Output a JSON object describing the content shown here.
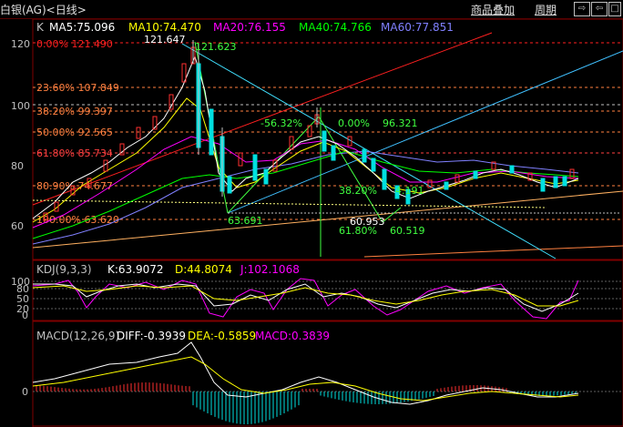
{
  "header": {
    "title": "白银(AG)<日线>",
    "overlay_btn": "商品叠加",
    "period_btn": "周期"
  },
  "main_legend": {
    "k": "K",
    "ma5": "MA5:75.096",
    "ma10": "MA10:74.470",
    "ma20": "MA20:76.155",
    "ma40": "MA40:74.766",
    "ma60": "MA60:77.851",
    "colors": {
      "ma5": "#ffffff",
      "ma10": "#ffff00",
      "ma20": "#ff00ff",
      "ma40": "#00ff00",
      "ma60": "#8080ff"
    }
  },
  "price_axis": [
    "120",
    "100",
    "80",
    "60"
  ],
  "fib_levels": [
    {
      "label": "0.00% 121.490",
      "color": "#ff2020",
      "value": 121.49
    },
    {
      "label": "23.60% 107.849",
      "color": "#ff8040",
      "value": 107.849
    },
    {
      "label": "38.20% 99.397",
      "color": "#ff8040",
      "value": 99.397
    },
    {
      "label": "50.00% 92.565",
      "color": "#ff8040",
      "value": 92.565
    },
    {
      "label": "61.80% 85.734",
      "color": "#ff4040",
      "value": 85.734
    },
    {
      "label": "80.90% 74.677",
      "color": "#ff8040",
      "value": 74.677
    },
    {
      "label": "100.00% 63.620",
      "color": "#ff8040",
      "value": 63.62
    }
  ],
  "annotations": {
    "high": "121.647",
    "high2": "121.623",
    "low1": "63.691",
    "low2": "60.953",
    "pct_neg": "-56.32%",
    "pct_zero": "0.00%",
    "val_96": "96.321",
    "pct_382": "38.20%",
    "val_4191": "4.191",
    "pct_618": "61.80%",
    "val_60519": "60.519"
  },
  "kdj_legend": {
    "name": "KDJ(9,3,3)",
    "k": "K:63.9072",
    "d": "D:44.8074",
    "j": "J:102.1068"
  },
  "kdj_axis": [
    "100",
    "80",
    "50",
    "20",
    "0"
  ],
  "macd_legend": {
    "name": "MACD(12,26,9)",
    "diff": "DIFF:-0.3939",
    "dea": "DEA:-0.5859",
    "macd": "MACD:0.3839"
  },
  "macd_axis": [
    "0"
  ]
}
